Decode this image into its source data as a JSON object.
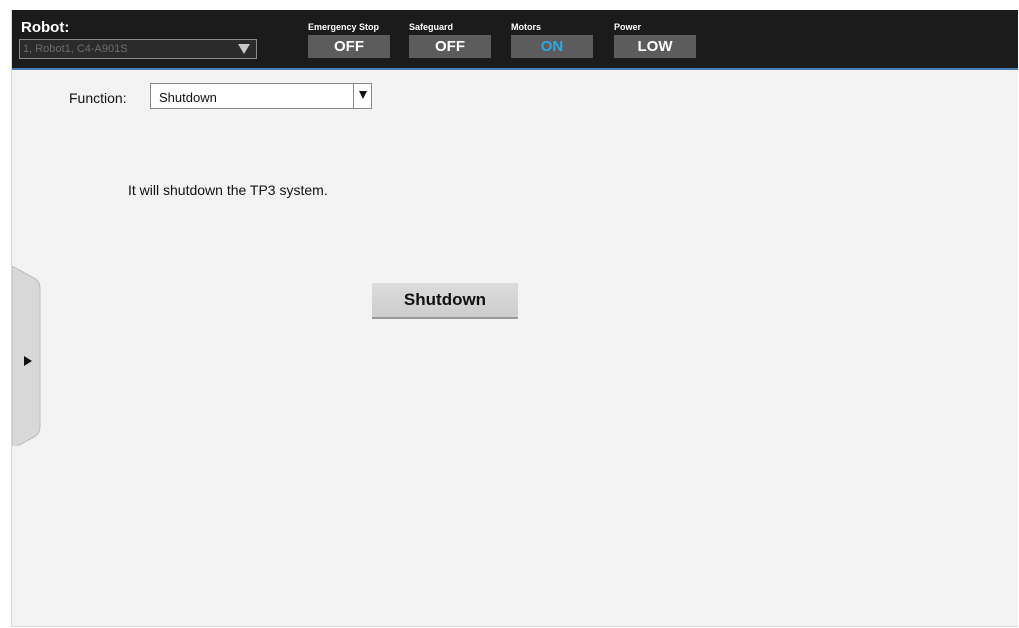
{
  "header": {
    "robot_label": "Robot:",
    "robot_value": "1, Robot1, C4-A901S",
    "status": [
      {
        "label": "Emergency Stop",
        "value": "OFF"
      },
      {
        "label": "Safeguard",
        "value": "OFF"
      },
      {
        "label": "Motors",
        "value": "ON"
      },
      {
        "label": "Power",
        "value": "LOW"
      }
    ]
  },
  "main": {
    "function_label": "Function:",
    "function_value": "Shutdown",
    "description": "It will shutdown the TP3 system.",
    "shutdown_button": "Shutdown"
  },
  "colors": {
    "accent_on": "#2da8e6",
    "topbar": "#1b1b1b",
    "status_box": "#5c5c5c"
  },
  "icons": {
    "robot_dropdown": "triangle-down-icon",
    "function_dropdown": "triangle-down-icon",
    "side_panel": "triangle-right-icon"
  }
}
